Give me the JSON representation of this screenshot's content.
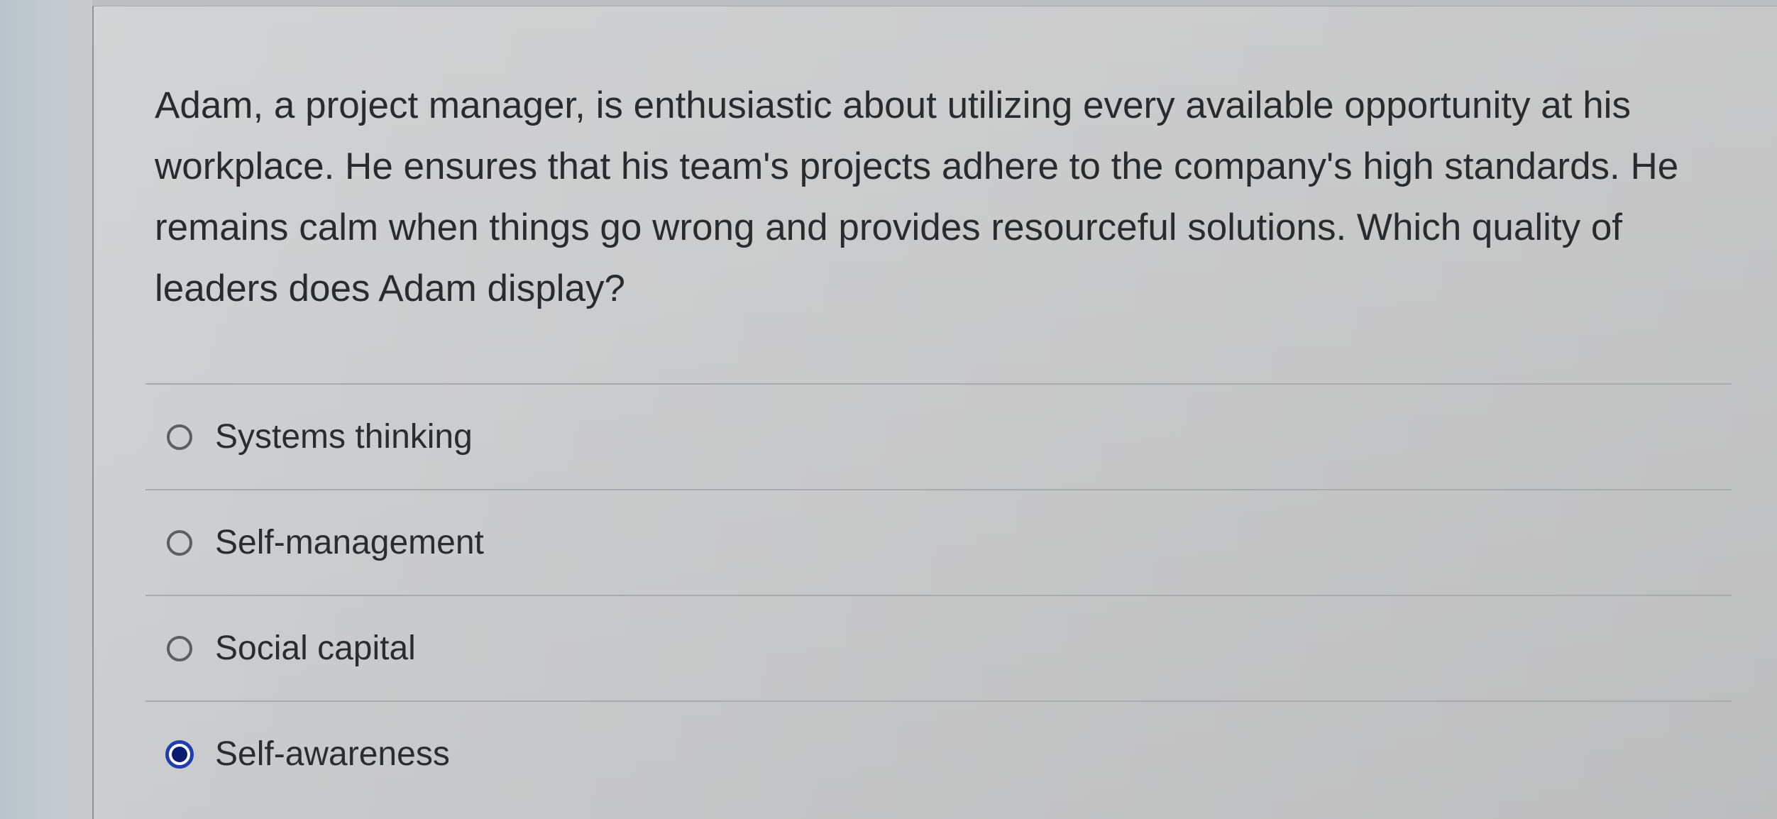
{
  "question": {
    "text": "Adam, a project manager, is enthusiastic about utilizing every available opportunity at his workplace. He ensures that his team's projects adhere to the company's high standards. He remains calm when things go wrong and provides resourceful solutions. Which quality of leaders does Adam display?"
  },
  "options": [
    {
      "label": "Systems thinking",
      "selected": false
    },
    {
      "label": "Self-management",
      "selected": false
    },
    {
      "label": "Social capital",
      "selected": false
    },
    {
      "label": "Self-awareness",
      "selected": true
    }
  ],
  "colors": {
    "selected_accent": "#1f3fb0",
    "text": "#2a2b2d"
  }
}
